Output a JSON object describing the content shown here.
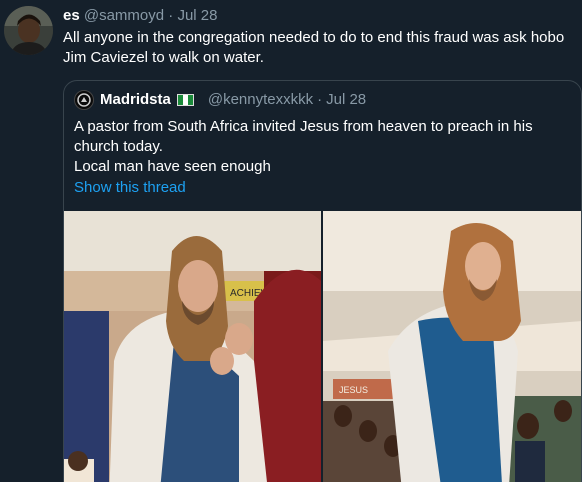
{
  "tweet": {
    "name": "es",
    "handle": "@sammoyd",
    "separator": "·",
    "date": "Jul 28",
    "text": "All anyone in the congregation needed to do to end this fraud was ask hobo Jim Caviezel to walk on water."
  },
  "quoted_tweet": {
    "name": "Madridsta",
    "flag_icon": "nigeria-flag-icon",
    "handle": "@kennytexxkkk",
    "separator": "·",
    "date": "Jul 28",
    "text_line1": "A pastor from South Africa invited Jesus from heaven to preach in his church today.",
    "text_line2": "Local man have seen enough",
    "thread_link": "Show this thread",
    "sign_text_left": "ACHIEVE",
    "sign_text_right": "JESUS"
  },
  "colors": {
    "background": "#15202b",
    "secondary_text": "#8899a6",
    "link": "#1da1f2",
    "border": "#38444d"
  }
}
